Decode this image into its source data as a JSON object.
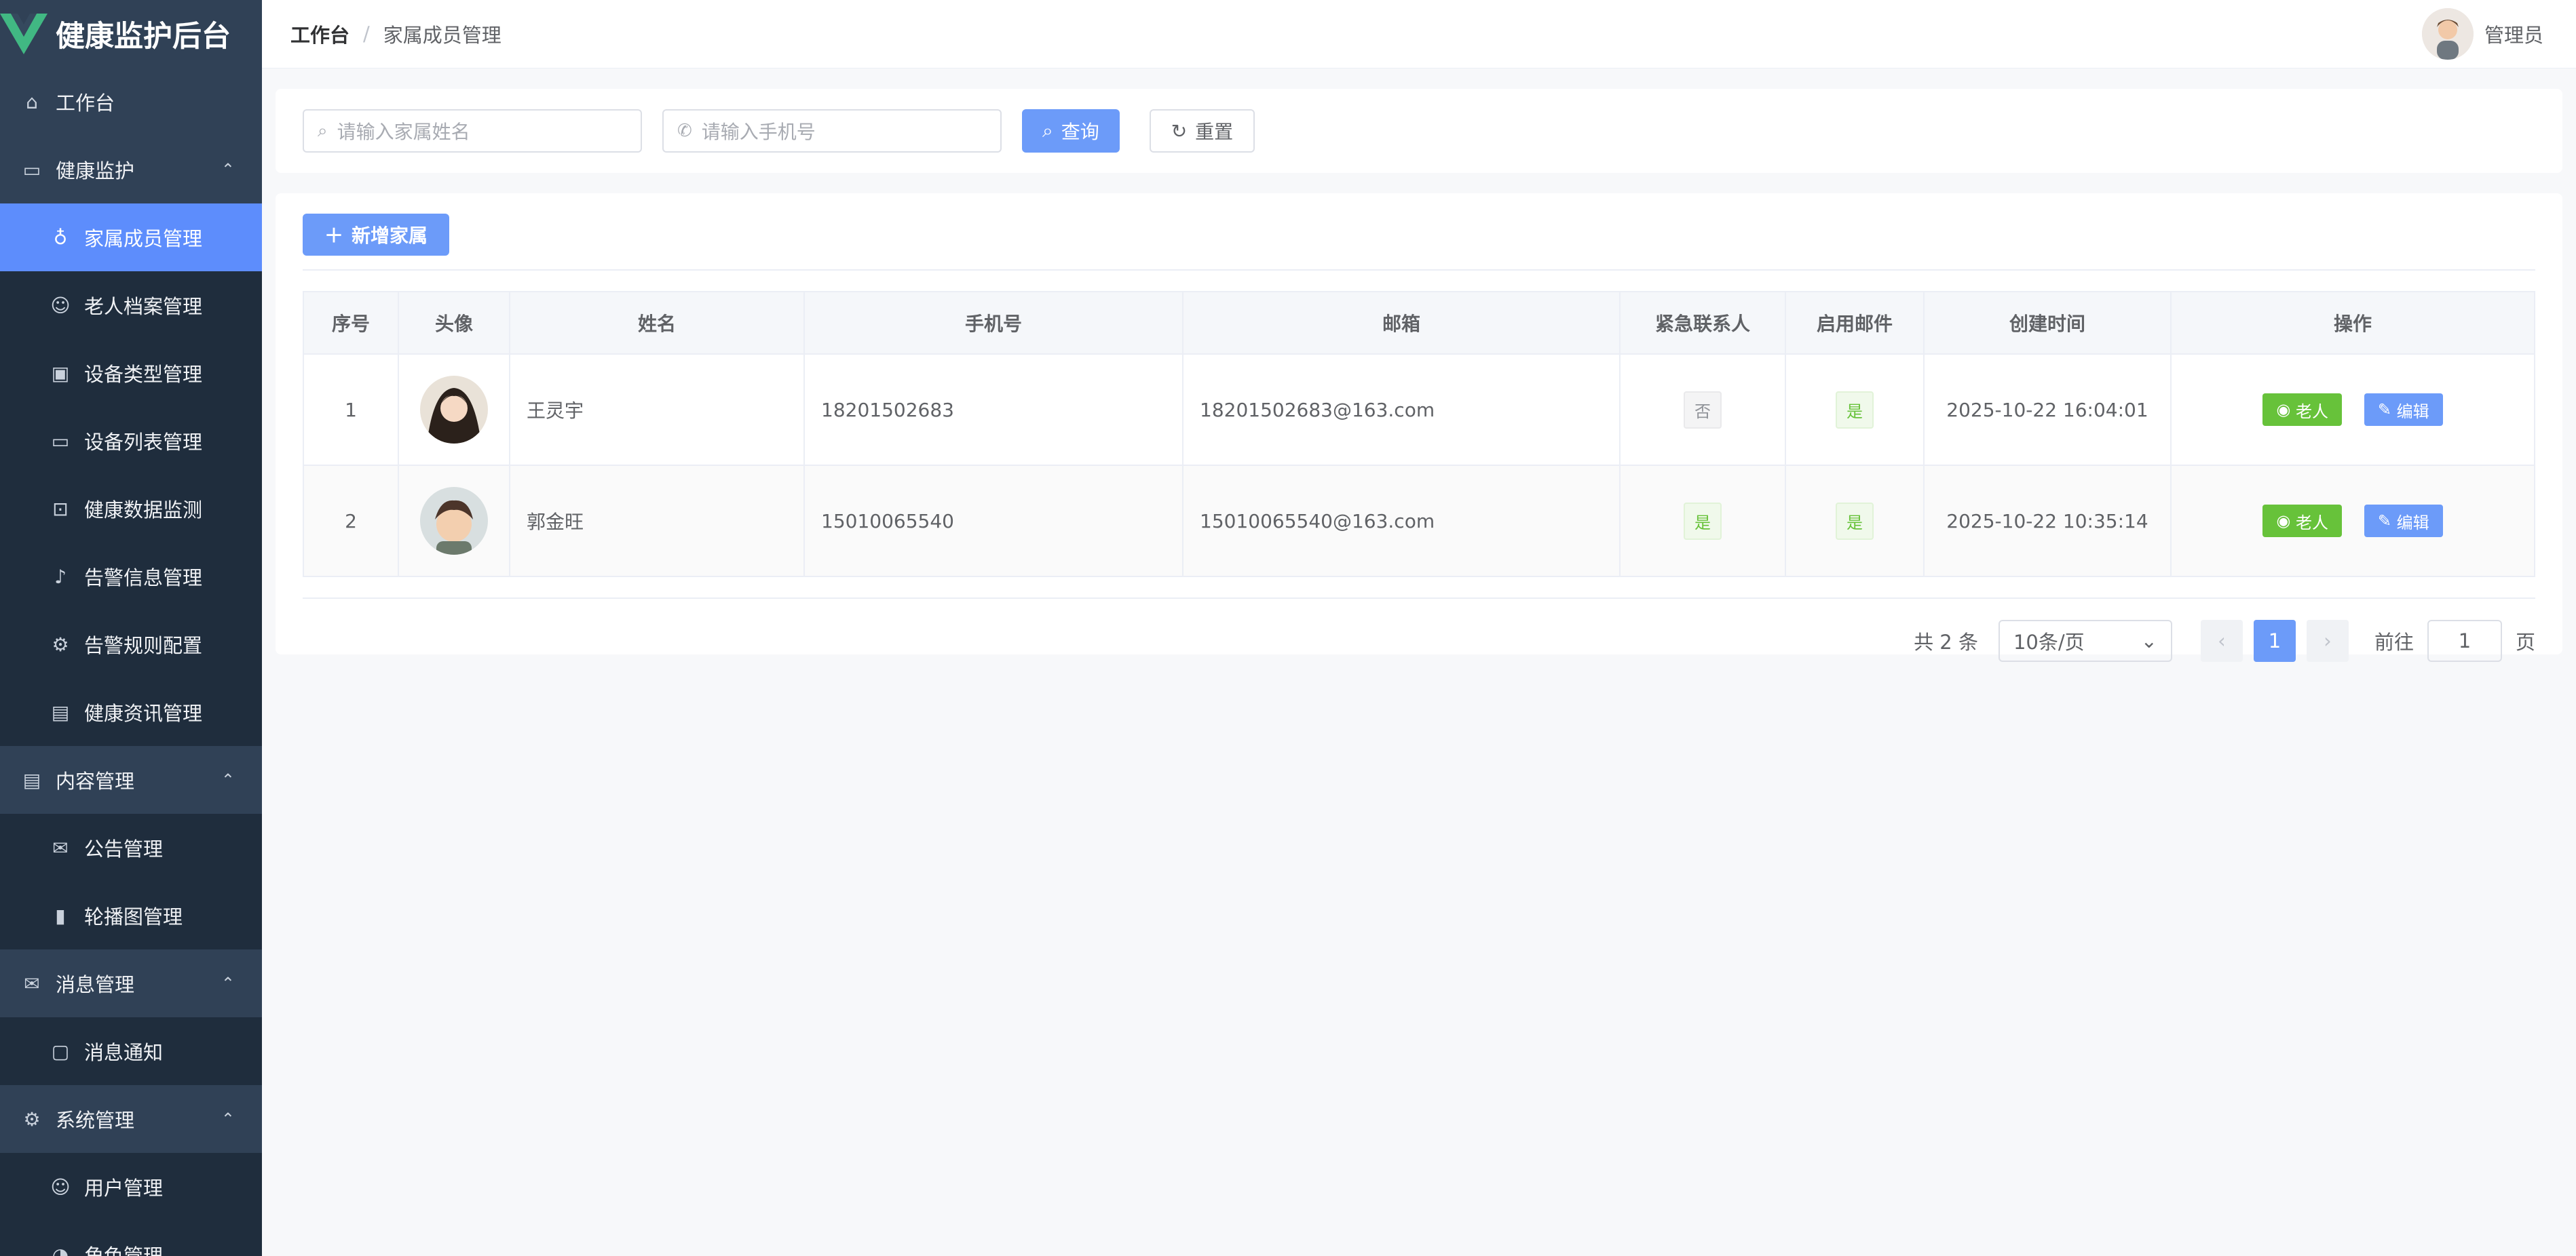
{
  "app": {
    "title": "健康监护后台",
    "user": "管理员"
  },
  "breadcrumb": [
    "工作台",
    "家属成员管理"
  ],
  "sidebar": [
    {
      "label": "工作台",
      "type": "top",
      "icon": "home-icon"
    },
    {
      "label": "健康监护",
      "type": "group",
      "icon": "monitor-icon"
    },
    {
      "label": "家属成员管理",
      "type": "sub",
      "icon": "bulb-icon",
      "active": true
    },
    {
      "label": "老人档案管理",
      "type": "sub",
      "icon": "user-icon"
    },
    {
      "label": "设备类型管理",
      "type": "sub",
      "icon": "box-icon"
    },
    {
      "label": "设备列表管理",
      "type": "sub",
      "icon": "screen-icon"
    },
    {
      "label": "健康数据监测",
      "type": "sub",
      "icon": "chart-screen-icon"
    },
    {
      "label": "告警信息管理",
      "type": "sub",
      "icon": "bell-icon"
    },
    {
      "label": "告警规则配置",
      "type": "sub",
      "icon": "gear-icon"
    },
    {
      "label": "健康资讯管理",
      "type": "sub",
      "icon": "document-icon"
    },
    {
      "label": "内容管理",
      "type": "group",
      "icon": "doc-icon"
    },
    {
      "label": "公告管理",
      "type": "sub",
      "icon": "mail-icon"
    },
    {
      "label": "轮播图管理",
      "type": "sub",
      "icon": "bar-chart-icon"
    },
    {
      "label": "消息管理",
      "type": "group",
      "icon": "mail-icon"
    },
    {
      "label": "消息通知",
      "type": "sub",
      "icon": "chat-icon"
    },
    {
      "label": "系统管理",
      "type": "group",
      "icon": "gear-icon"
    },
    {
      "label": "用户管理",
      "type": "sub",
      "icon": "user-icon"
    },
    {
      "label": "角色管理",
      "type": "sub",
      "icon": "role-icon"
    }
  ],
  "search": {
    "name_placeholder": "请输入家属姓名",
    "phone_placeholder": "请输入手机号",
    "query": "查询",
    "reset": "重置"
  },
  "actions": {
    "add": "新增家属"
  },
  "table": {
    "headers": [
      "序号",
      "头像",
      "姓名",
      "手机号",
      "邮箱",
      "紧急联系人",
      "启用邮件",
      "创建时间",
      "操作"
    ],
    "rows": [
      {
        "idx": "1",
        "name": "王灵宇",
        "phone": "18201502683",
        "email": "18201502683@163.com",
        "emergency": "否",
        "email_enabled": "是",
        "created": "2025-10-22 16:04:01"
      },
      {
        "idx": "2",
        "name": "郭金旺",
        "phone": "15010065540",
        "email": "15010065540@163.com",
        "emergency": "是",
        "email_enabled": "是",
        "created": "2025-10-22 10:35:14"
      }
    ],
    "op_view": "老人",
    "op_edit": "编辑"
  },
  "pager": {
    "total": "共 2 条",
    "size": "10条/页",
    "current": "1",
    "goto": "前往",
    "goto_value": "1",
    "unit": "页"
  }
}
